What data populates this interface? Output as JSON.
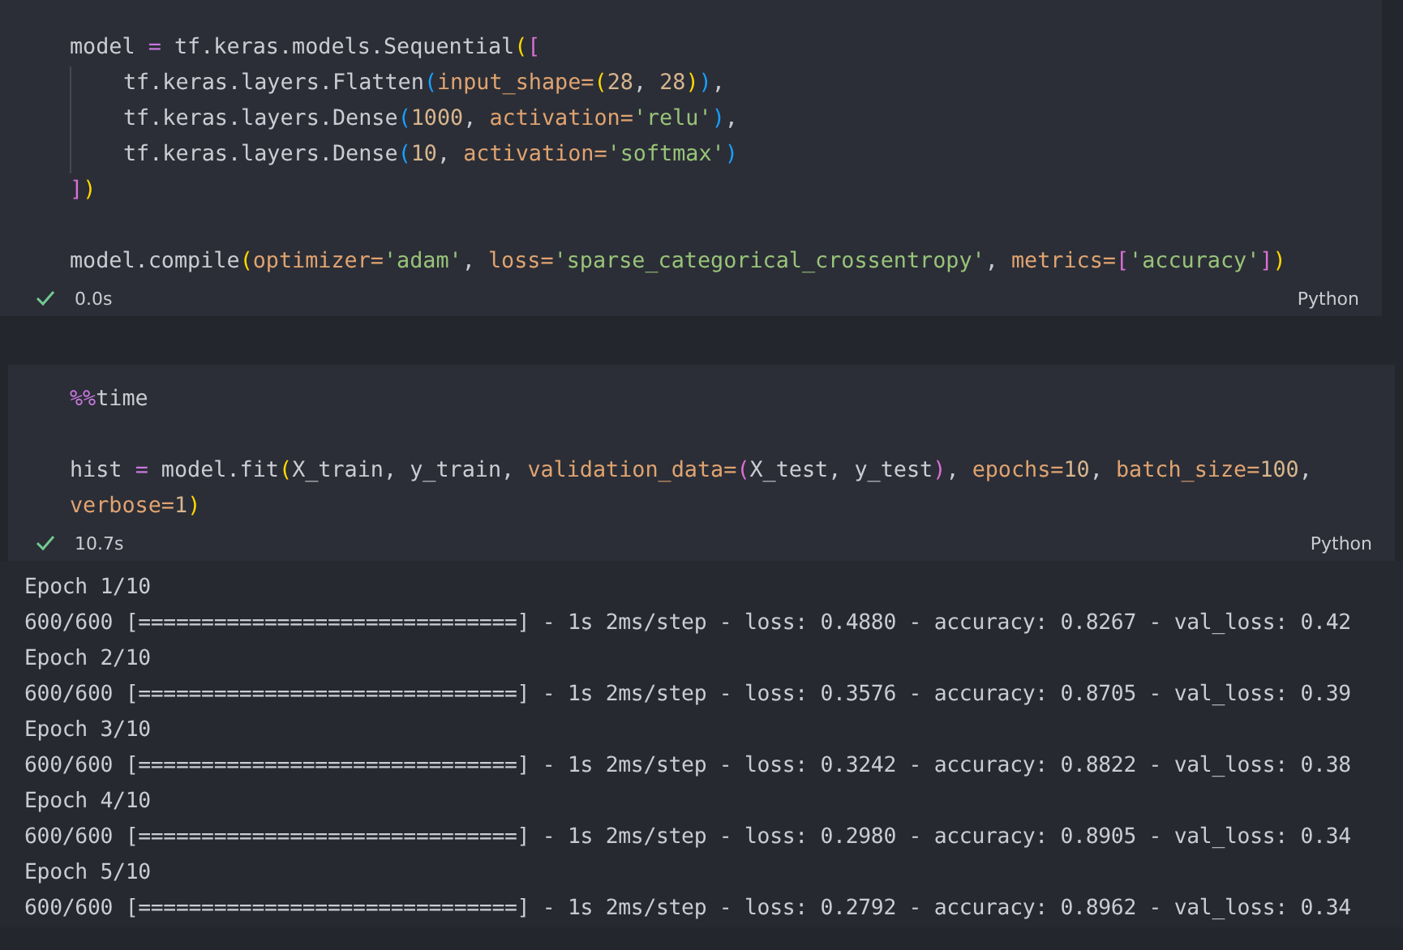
{
  "cells": [
    {
      "blocks": [
        [
          {
            "indented": false,
            "tokens": [
              {
                "kind": "plain",
                "text": "model "
              },
              {
                "kind": "op",
                "text": "="
              },
              {
                "kind": "plain",
                "text": " tf.keras.models.Sequential"
              },
              {
                "kind": "b1",
                "text": "("
              },
              {
                "kind": "b2",
                "text": "["
              }
            ]
          },
          {
            "indented": true,
            "tokens": [
              {
                "kind": "plain",
                "text": "tf.keras.layers.Flatten"
              },
              {
                "kind": "b3",
                "text": "("
              },
              {
                "kind": "param",
                "text": "input_shape="
              },
              {
                "kind": "b1",
                "text": "("
              },
              {
                "kind": "number",
                "text": "28"
              },
              {
                "kind": "plain",
                "text": ", "
              },
              {
                "kind": "number",
                "text": "28"
              },
              {
                "kind": "b1",
                "text": ")"
              },
              {
                "kind": "b3",
                "text": ")"
              },
              {
                "kind": "plain",
                "text": ","
              }
            ]
          },
          {
            "indented": true,
            "tokens": [
              {
                "kind": "plain",
                "text": "tf.keras.layers.Dense"
              },
              {
                "kind": "b3",
                "text": "("
              },
              {
                "kind": "number",
                "text": "1000"
              },
              {
                "kind": "plain",
                "text": ", "
              },
              {
                "kind": "param",
                "text": "activation="
              },
              {
                "kind": "string",
                "text": "'relu'"
              },
              {
                "kind": "b3",
                "text": ")"
              },
              {
                "kind": "plain",
                "text": ","
              }
            ]
          },
          {
            "indented": true,
            "tokens": [
              {
                "kind": "plain",
                "text": "tf.keras.layers.Dense"
              },
              {
                "kind": "b3",
                "text": "("
              },
              {
                "kind": "number",
                "text": "10"
              },
              {
                "kind": "plain",
                "text": ", "
              },
              {
                "kind": "param",
                "text": "activation="
              },
              {
                "kind": "string",
                "text": "'softmax'"
              },
              {
                "kind": "b3",
                "text": ")"
              }
            ]
          },
          {
            "indented": false,
            "tokens": [
              {
                "kind": "b2",
                "text": "]"
              },
              {
                "kind": "b1",
                "text": ")"
              }
            ]
          }
        ],
        [
          {
            "indented": false,
            "tokens": [
              {
                "kind": "plain",
                "text": "model.compile"
              },
              {
                "kind": "b1",
                "text": "("
              },
              {
                "kind": "param",
                "text": "optimizer="
              },
              {
                "kind": "string",
                "text": "'adam'"
              },
              {
                "kind": "plain",
                "text": ", "
              },
              {
                "kind": "param",
                "text": "loss="
              },
              {
                "kind": "string",
                "text": "'sparse_categorical_crossentropy'"
              },
              {
                "kind": "plain",
                "text": ", "
              },
              {
                "kind": "param",
                "text": "metrics="
              },
              {
                "kind": "b2",
                "text": "["
              },
              {
                "kind": "string",
                "text": "'accuracy'"
              },
              {
                "kind": "b2",
                "text": "]"
              },
              {
                "kind": "b1",
                "text": ")"
              }
            ]
          }
        ]
      ],
      "status": {
        "ok": true,
        "duration": "0.0s",
        "language": "Python"
      }
    },
    {
      "blocks": [
        [
          {
            "indented": false,
            "tokens": [
              {
                "kind": "magic",
                "text": "%%"
              },
              {
                "kind": "plain",
                "text": "time"
              }
            ]
          }
        ],
        [
          {
            "indented": false,
            "tokens": [
              {
                "kind": "plain",
                "text": "hist "
              },
              {
                "kind": "op",
                "text": "="
              },
              {
                "kind": "plain",
                "text": " model.fit"
              },
              {
                "kind": "b1",
                "text": "("
              },
              {
                "kind": "plain",
                "text": "X_train, y_train, "
              },
              {
                "kind": "param",
                "text": "validation_data="
              },
              {
                "kind": "b2",
                "text": "("
              },
              {
                "kind": "plain",
                "text": "X_test, y_test"
              },
              {
                "kind": "b2",
                "text": ")"
              },
              {
                "kind": "plain",
                "text": ", "
              },
              {
                "kind": "param",
                "text": "epochs="
              },
              {
                "kind": "number",
                "text": "10"
              },
              {
                "kind": "plain",
                "text": ", "
              },
              {
                "kind": "param",
                "text": "batch_size="
              },
              {
                "kind": "number",
                "text": "100"
              },
              {
                "kind": "plain",
                "text": ","
              }
            ]
          },
          {
            "indented": false,
            "tokens": [
              {
                "kind": "param",
                "text": "verbose="
              },
              {
                "kind": "number",
                "text": "1"
              },
              {
                "kind": "b1",
                "text": ")"
              }
            ]
          }
        ]
      ],
      "status": {
        "ok": true,
        "duration": "10.7s",
        "language": "Python"
      }
    }
  ],
  "output": [
    "Epoch 1/10",
    "600/600 [==============================] - 1s 2ms/step - loss: 0.4880 - accuracy: 0.8267 - val_loss: 0.42",
    "Epoch 2/10",
    "600/600 [==============================] - 1s 2ms/step - loss: 0.3576 - accuracy: 0.8705 - val_loss: 0.39",
    "Epoch 3/10",
    "600/600 [==============================] - 1s 2ms/step - loss: 0.3242 - accuracy: 0.8822 - val_loss: 0.38",
    "Epoch 4/10",
    "600/600 [==============================] - 1s 2ms/step - loss: 0.2980 - accuracy: 0.8905 - val_loss: 0.34",
    "Epoch 5/10",
    "600/600 [==============================] - 1s 2ms/step - loss: 0.2792 - accuracy: 0.8962 - val_loss: 0.34"
  ]
}
